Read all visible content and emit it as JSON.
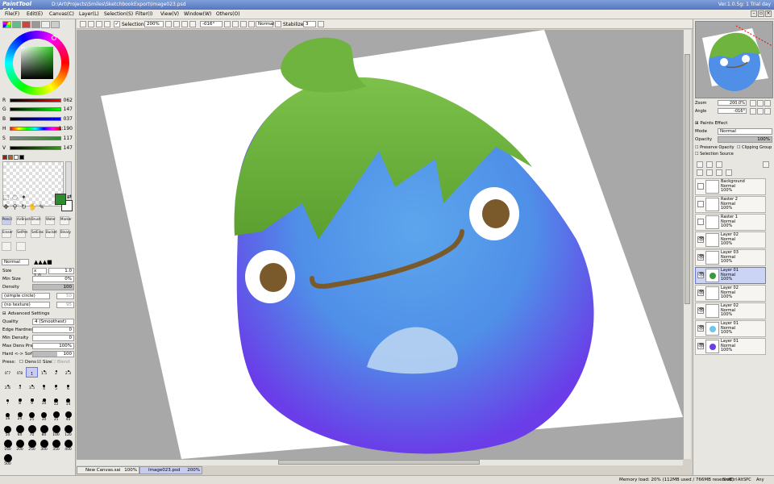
{
  "titlebar": {
    "logo": "PaintTool SAI",
    "path": "D:\\Art\\Projects\\Smiles\\SketchbookExport\\Image023.psd",
    "version": "Ver.1.0.5g: 1 Trial day"
  },
  "menu": [
    "File(F)",
    "Edit(E)",
    "Canvas(C)",
    "Layer(L)",
    "Selection(S)",
    "Filter(I)",
    "View(V)",
    "Window(W)",
    "Others(O)"
  ],
  "toolbar": {
    "selection_label": "Selection",
    "zoom": "200%",
    "angle": "-016°",
    "blend": "Normal",
    "stabilizer_label": "Stabilizer",
    "stabilizer": "3"
  },
  "colors": {
    "primary": "#2e8b2e",
    "secondary": "#ffffff"
  },
  "sliders": [
    {
      "label": "R",
      "value": "062",
      "track": "linear-gradient(90deg,#000,#f00)"
    },
    {
      "label": "G",
      "value": "147",
      "track": "linear-gradient(90deg,#000,#0f0)"
    },
    {
      "label": "B",
      "value": "037",
      "track": "linear-gradient(90deg,#000,#00f)"
    },
    {
      "label": "H",
      "value": "1:190",
      "track": "linear-gradient(90deg,#f00,#ff0,#0f0,#0ff,#00f,#f0f,#f00)"
    },
    {
      "label": "S",
      "value": "117",
      "track": "linear-gradient(90deg,#888,#2e8b2e)"
    },
    {
      "label": "V",
      "value": "147",
      "track": "linear-gradient(90deg,#000,#3e9325)"
    }
  ],
  "brushes": [
    "Pencil",
    "AirBrush",
    "Brush",
    "Water",
    "Marker",
    "Eraser",
    "SelPen",
    "SelEras",
    "Bucket",
    "Binary"
  ],
  "brush_settings": {
    "mode": "Normal",
    "size_label": "Size",
    "size_mult": "x 1.0",
    "size": "1.0",
    "minsize_label": "Min Size",
    "minsize": "0%",
    "density_label": "Density",
    "density": "100",
    "shape": "(simple circle)",
    "shape_val": "50",
    "texture": "(no texture)",
    "texture_val": "95",
    "advanced_label": "Advanced Settings",
    "quality_label": "Quality",
    "quality": "4 (Smoothest)",
    "edge_label": "Edge Hardness",
    "edge": "0",
    "mindens_label": "Min Density",
    "mindens": "0",
    "maxdens_label": "Max Dens Prs.",
    "maxdens": "100%",
    "hardsoft_label": "Hard <-> Soft",
    "hardsoft": "100",
    "press_label": "Press:",
    "dens_chk": "Dens",
    "size_chk": "Size",
    "blend_chk": "Blend"
  },
  "dot_sizes": [
    "0.7",
    "0.8",
    "1",
    "1.5",
    "2",
    "2.3",
    "2.6",
    "3",
    "3.5",
    "4",
    "5",
    "6",
    "7",
    "8",
    "9",
    "10",
    "12",
    "14",
    "16",
    "20",
    "25",
    "30",
    "35",
    "40",
    "50",
    "60",
    "70",
    "80",
    "100",
    "120",
    "160",
    "200",
    "250",
    "300",
    "350",
    "400",
    "500"
  ],
  "navigator": {
    "zoom_label": "Zoom",
    "zoom": "200.0%",
    "angle_label": "Angle",
    "angle": "-016°"
  },
  "layer_panel": {
    "paints_effect": "Paints Effect",
    "mode_label": "Mode",
    "mode": "Normal",
    "opacity_label": "Opacity",
    "opacity": "100%",
    "preserve": "Preserve Opacity",
    "clipping": "Clipping Group",
    "selsource": "Selection Source"
  },
  "layers": [
    {
      "name": "Background",
      "mode": "Normal",
      "opacity": "100%"
    },
    {
      "name": "Raster 2",
      "mode": "Normal",
      "opacity": "100%"
    },
    {
      "name": "Raster 1",
      "mode": "Normal",
      "opacity": "100%"
    },
    {
      "name": "Layer 02",
      "mode": "Normal",
      "opacity": "100%"
    },
    {
      "name": "Layer 03",
      "mode": "Normal",
      "opacity": "100%"
    },
    {
      "name": "Layer 01",
      "mode": "Normal",
      "opacity": "100%"
    },
    {
      "name": "Layer 02",
      "mode": "Normal",
      "opacity": "100%"
    },
    {
      "name": "Layer 02",
      "mode": "Normal",
      "opacity": "100%"
    },
    {
      "name": "Layer 01",
      "mode": "Normal",
      "opacity": "100%"
    },
    {
      "name": "Layer 01",
      "mode": "Normal",
      "opacity": "100%"
    }
  ],
  "docs": [
    {
      "name": "New Canvas.sai",
      "zoom": "100%"
    },
    {
      "name": "Image023.psd",
      "zoom": "200%"
    }
  ],
  "status": {
    "memory": "Memory load: 20% (112MB used / 766MB reserved)",
    "keys": [
      "Shift",
      "Ctrl",
      "Alt",
      "SPC",
      "Any"
    ]
  }
}
